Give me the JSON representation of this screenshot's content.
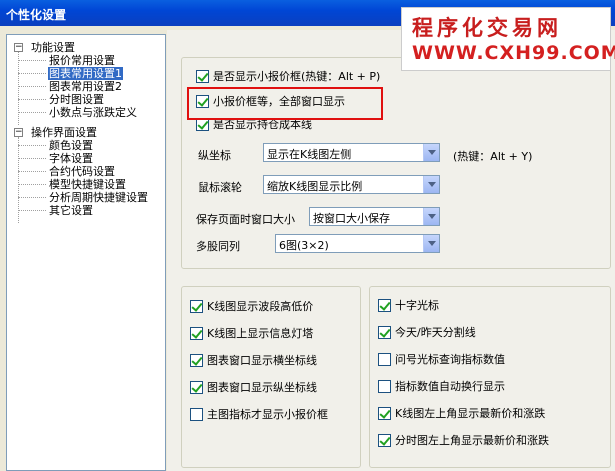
{
  "window": {
    "title": "个性化设置"
  },
  "watermark": {
    "line1": "程序化交易网",
    "line2": "WWW.CXH99.COM"
  },
  "tree": {
    "groups": [
      {
        "label": "功能设置",
        "items": [
          "报价常用设置",
          "图表常用设置1",
          "图表常用设置2",
          "分时图设置",
          "小数点与涨跌定义"
        ]
      },
      {
        "label": "操作界面设置",
        "items": [
          "颜色设置",
          "字体设置",
          "合约代码设置",
          "模型快捷键设置",
          "分析周期快捷键设置",
          "其它设置"
        ]
      }
    ],
    "selected": "图表常用设置1"
  },
  "top": {
    "chk1": {
      "label": "是否显示小报价框(热键：Alt + P)",
      "checked": true
    },
    "chk2": {
      "label": "小报价框等，全部窗口显示",
      "checked": true
    },
    "chk3": {
      "label": "是否显示持仓成本线",
      "checked": true
    },
    "axis": {
      "label": "纵坐标",
      "value": "显示在K线图左侧",
      "hotkey": "(热键：Alt + Y)"
    },
    "wheel": {
      "label": "鼠标滚轮",
      "value": "缩放K线图显示比例"
    },
    "save": {
      "label": "保存页面时窗口大小",
      "value": "按窗口大小保存"
    },
    "multi": {
      "label": "多股同列",
      "value": "6图(3×2)"
    }
  },
  "left_group": [
    {
      "label": "K线图显示波段高低价",
      "checked": true
    },
    {
      "label": "K线图上显示信息灯塔",
      "checked": true
    },
    {
      "label": "图表窗口显示横坐标线",
      "checked": true
    },
    {
      "label": "图表窗口显示纵坐标线",
      "checked": true
    },
    {
      "label": "主图指标才显示小报价框",
      "checked": false
    }
  ],
  "right_group": [
    {
      "label": "十字光标",
      "checked": true
    },
    {
      "label": "今天/昨天分割线",
      "checked": true
    },
    {
      "label": "问号光标查询指标数值",
      "checked": false
    },
    {
      "label": "指标数值自动换行显示",
      "checked": false
    },
    {
      "label": "K线图左上角显示最新价和涨跌",
      "checked": true
    },
    {
      "label": "分时图左上角显示最新价和涨跌",
      "checked": true
    }
  ]
}
